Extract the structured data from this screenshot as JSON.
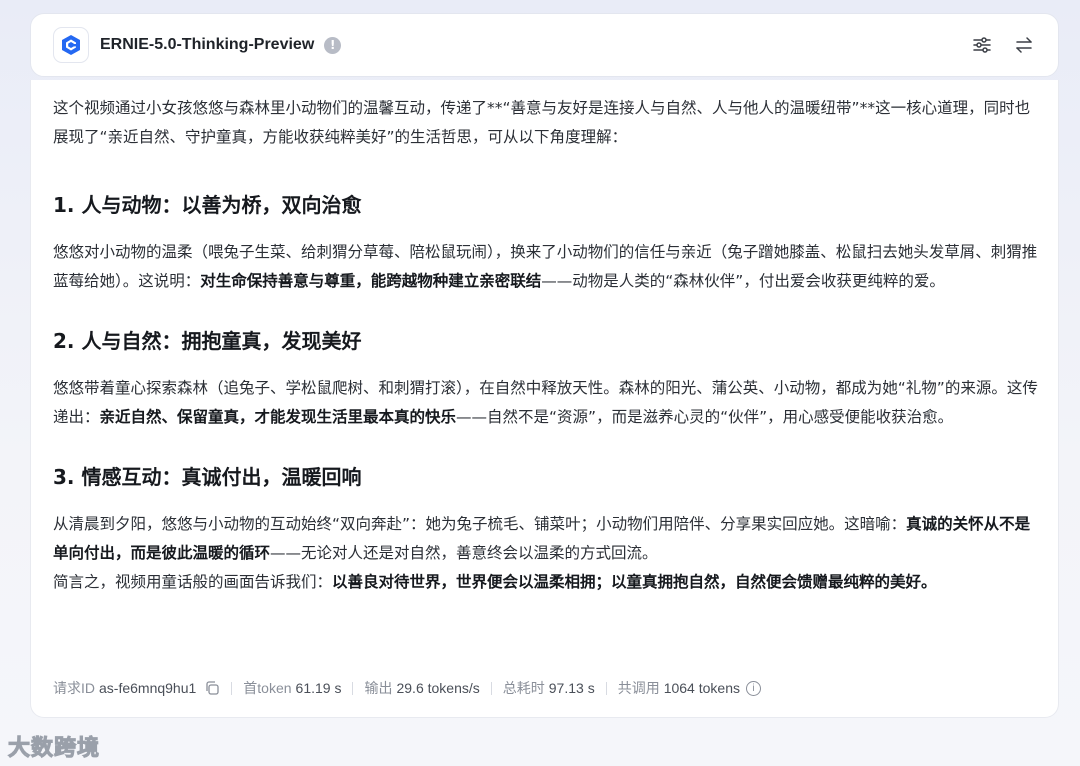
{
  "header": {
    "model_name": "ERNIE-5.0-Thinking-Preview",
    "info_icon": "!"
  },
  "content": {
    "intro": "这个视频通过小女孩悠悠与森林里小动物们的温馨互动，传递了**“善意与友好是连接人与自然、人与他人的温暖纽带”**这一核心道理，同时也展现了“亲近自然、守护童真，方能收获纯粹美好”的生活哲思，可从以下角度理解：",
    "section1": {
      "heading": "1. 人与动物：以善为桥，双向治愈",
      "text_a": "悠悠对小动物的温柔（喂兔子生菜、给刺猬分草莓、陪松鼠玩闹），换来了小动物们的信任与亲近（兔子蹭她膝盖、松鼠扫去她头发草屑、刺猬推蓝莓给她）。这说明：",
      "bold": "对生命保持善意与尊重，能跨越物种建立亲密联结",
      "text_b": "——动物是人类的“森林伙伴”，付出爱会收获更纯粹的爱。"
    },
    "section2": {
      "heading": "2. 人与自然：拥抱童真，发现美好",
      "text_a": "悠悠带着童心探索森林（追兔子、学松鼠爬树、和刺猬打滚），在自然中释放天性。森林的阳光、蒲公英、小动物，都成为她“礼物”的来源。这传递出：",
      "bold": "亲近自然、保留童真，才能发现生活里最本真的快乐",
      "text_b": "——自然不是“资源”，而是滋养心灵的“伙伴”，用心感受便能收获治愈。"
    },
    "section3": {
      "heading": "3. 情感互动：真诚付出，温暖回响",
      "text_a": "从清晨到夕阳，悠悠与小动物的互动始终“双向奔赴”：她为兔子梳毛、铺菜叶；小动物们用陪伴、分享果实回应她。这暗喻：",
      "bold": "真诚的关怀从不是单向付出，而是彼此温暖的循环",
      "text_b": "——无论对人还是对自然，善意终会以温柔的方式回流。"
    },
    "summary": {
      "text_a": "简言之，视频用童话般的画面告诉我们：",
      "bold": "以善良对待世界，世界便会以温柔相拥；以童真拥抱自然，自然便会馈赠最纯粹的美好。"
    }
  },
  "footer": {
    "request_id_label": "请求ID",
    "request_id": "as-fe6mnq9hu1",
    "first_token_label": "首token",
    "first_token": "61.19 s",
    "output_label": "输出",
    "output": "29.6 tokens/s",
    "total_time_label": "总耗时",
    "total_time": "97.13 s",
    "total_calls_label": "共调用",
    "total_calls": "1064 tokens"
  },
  "watermark": "大数跨境",
  "colors": {
    "brand_blue": "#2468f2",
    "text": "#2b2f36",
    "muted": "#8a8f99"
  }
}
